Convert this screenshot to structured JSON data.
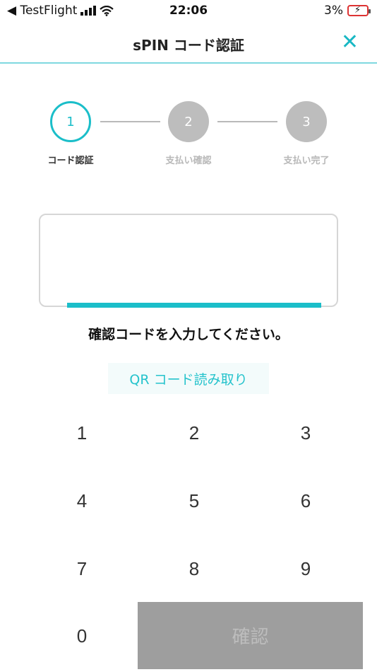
{
  "status_bar": {
    "back_app": "◀ TestFlight",
    "time": "22:06",
    "battery": "3%"
  },
  "header": {
    "title": "sPIN コード認証",
    "close_icon": "close-icon"
  },
  "stepper": {
    "steps": [
      {
        "number": "1",
        "label": "コード認証",
        "state": "active"
      },
      {
        "number": "2",
        "label": "支払い確認",
        "state": "inactive"
      },
      {
        "number": "3",
        "label": "支払い完了",
        "state": "inactive"
      }
    ]
  },
  "code_input": {
    "value": "",
    "prompt": "確認コードを入力してください。"
  },
  "qr_button": {
    "label": "QR コード読み取り"
  },
  "keypad": {
    "keys": [
      "1",
      "2",
      "3",
      "4",
      "5",
      "6",
      "7",
      "8",
      "9",
      "0"
    ],
    "confirm_label": "確認"
  },
  "colors": {
    "accent": "#1bbec9",
    "inactive_step": "#bdbdbd",
    "confirm_bg": "#9e9e9e"
  }
}
